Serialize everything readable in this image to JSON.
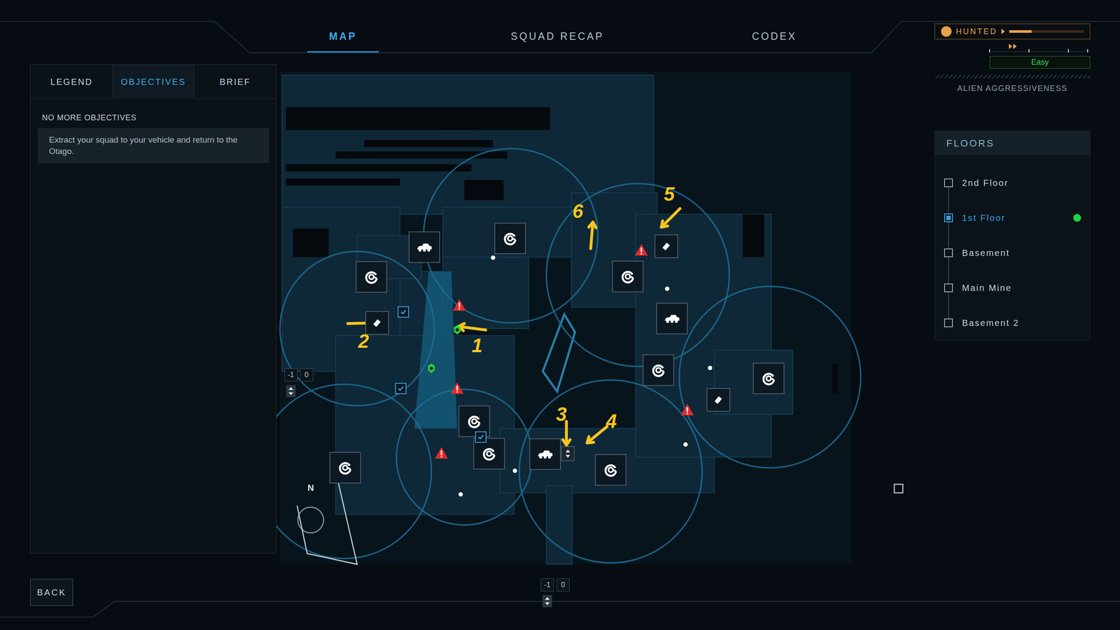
{
  "top_tabs": [
    {
      "label": "MAP",
      "selected": true
    },
    {
      "label": "SQUAD RECAP",
      "selected": false
    },
    {
      "label": "CODEX",
      "selected": false
    }
  ],
  "side_tabs": [
    {
      "label": "LEGEND",
      "selected": false
    },
    {
      "label": "OBJECTIVES",
      "selected": true
    },
    {
      "label": "BRIEF",
      "selected": false
    }
  ],
  "objectives": {
    "heading": "NO MORE OBJECTIVES",
    "items": [
      "Extract your squad to your vehicle and return to the Otago."
    ]
  },
  "status": {
    "label": "HUNTED",
    "level": 0.3,
    "difficulty": "Easy",
    "caption": "ALIEN AGGRESSIVENESS"
  },
  "floors": {
    "title": "FLOORS",
    "items": [
      {
        "label": "2nd Floor",
        "selected": false,
        "current": false
      },
      {
        "label": "1st Floor",
        "selected": true,
        "current": true
      },
      {
        "label": "Basement",
        "selected": false,
        "current": false
      },
      {
        "label": "Main Mine",
        "selected": false,
        "current": false
      },
      {
        "label": "Basement 2",
        "selected": false,
        "current": false
      }
    ]
  },
  "back_button": "BACK",
  "lifts": [
    {
      "levels": [
        "-1",
        "0"
      ]
    },
    {
      "levels": [
        "-1",
        "0"
      ]
    }
  ],
  "compass": "N",
  "map_pins": [
    {
      "kind": "vehicle"
    },
    {
      "kind": "sentry"
    },
    {
      "kind": "sentry"
    },
    {
      "kind": "item"
    },
    {
      "kind": "sentry"
    },
    {
      "kind": "sentry"
    },
    {
      "kind": "sentry"
    },
    {
      "kind": "vehicle"
    },
    {
      "kind": "lift"
    },
    {
      "kind": "sentry"
    },
    {
      "kind": "sentry"
    },
    {
      "kind": "item"
    },
    {
      "kind": "vehicle"
    },
    {
      "kind": "sentry"
    },
    {
      "kind": "sentry"
    },
    {
      "kind": "item"
    },
    {
      "kind": "terminal"
    },
    {
      "kind": "terminal"
    },
    {
      "kind": "terminal"
    },
    {
      "kind": "warning"
    },
    {
      "kind": "warning"
    },
    {
      "kind": "warning"
    },
    {
      "kind": "warning"
    },
    {
      "kind": "warning"
    },
    {
      "kind": "squad"
    },
    {
      "kind": "squad"
    },
    {
      "kind": "dot"
    },
    {
      "kind": "dot"
    },
    {
      "kind": "dot"
    },
    {
      "kind": "dot"
    },
    {
      "kind": "dot"
    },
    {
      "kind": "dot"
    }
  ],
  "annotations": [
    {
      "label": "1"
    },
    {
      "label": "2"
    },
    {
      "label": "3"
    },
    {
      "label": "4"
    },
    {
      "label": "5"
    },
    {
      "label": "6"
    }
  ]
}
